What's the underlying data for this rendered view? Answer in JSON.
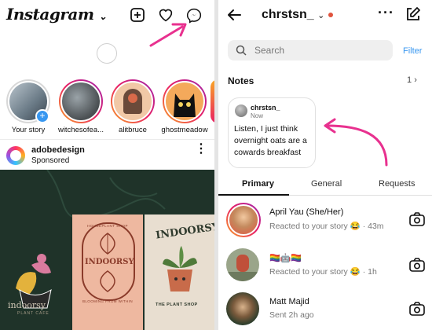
{
  "left": {
    "logo": "Instagram",
    "stories": [
      {
        "label": "Your story"
      },
      {
        "label": "witchesofea..."
      },
      {
        "label": "alitbruce"
      },
      {
        "label": "ghostmeadow"
      }
    ],
    "post": {
      "username": "adobedesign",
      "sponsored": "Sponsored",
      "panel_texts": [
        "indoorsy",
        "PLANT CAFE",
        "HOUSEPLANT SHOP",
        "INDOORSY",
        "BLOOMING FROM WITHIN",
        "INDOORSY",
        "THE PLANT SHOP"
      ]
    }
  },
  "right": {
    "username": "chrstsn_",
    "search_placeholder": "Search",
    "filter": "Filter",
    "notes_title": "Notes",
    "notes_count": "1",
    "note": {
      "user": "chrstsn_",
      "time": "Now",
      "text": "Listen, I just think overnight oats are a cowards breakfast"
    },
    "tabs": [
      "Primary",
      "General",
      "Requests"
    ],
    "messages": [
      {
        "name": "April Yau (She/Her)",
        "sub": "Reacted to your story 😂 · 43m"
      },
      {
        "name": "🏳️‍🌈🤖🏳️‍🌈",
        "sub": "Reacted to your story 😂 · 1h"
      },
      {
        "name": "Matt Majid",
        "sub": "Sent 2h ago"
      }
    ]
  },
  "colors": {
    "accent": "#3897f0",
    "annotation": "#e8318f",
    "feed_bg": "#1f3329"
  }
}
